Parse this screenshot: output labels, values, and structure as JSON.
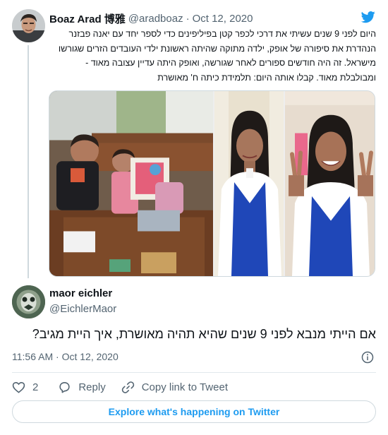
{
  "parent_tweet": {
    "author_name": "Boaz Arad 博雅",
    "handle": "@aradboaz",
    "separator": "·",
    "date": "Oct 12, 2020",
    "text": "היום לפני 9 שנים עשיתי את דרכי לכפר קטן בפיליפינים כדי לספר יחד עם יאנה פבזנר הנהדרת את סיפורה של אופק, ילדה מתוקה שהיתה ראשונת ילדי העובדים הזרים שגורשו מישראל. זה היה חודשים ספורים לאחר שגורשה, ואופק היתה עדיין עצובה מאוד - ומבולבלת מאוד. קבלו אותה היום: תלמידת כיתה ח' מאושרת"
  },
  "main_tweet": {
    "author_name": "maor eichler",
    "handle": "@EichlerMaor",
    "text": "אם הייתי מנבא לפני 9 שנים שהיא תהיה מאושרת, איך היית מגיב?",
    "time": "11:56 AM",
    "separator": "·",
    "date": "Oct 12, 2020"
  },
  "actions": {
    "like_count": "2",
    "reply_label": "Reply",
    "copy_link_label": "Copy link to Tweet"
  },
  "explore_label": "Explore what's happening on Twitter",
  "icons": {
    "brand": "twitter-bird-icon",
    "info": "info-icon",
    "like": "heart-icon",
    "reply": "speech-bubble-icon",
    "copy": "link-icon"
  },
  "colors": {
    "brand_blue": "#1d9bf0",
    "secondary_text": "#536471",
    "border": "#cfd9de"
  }
}
